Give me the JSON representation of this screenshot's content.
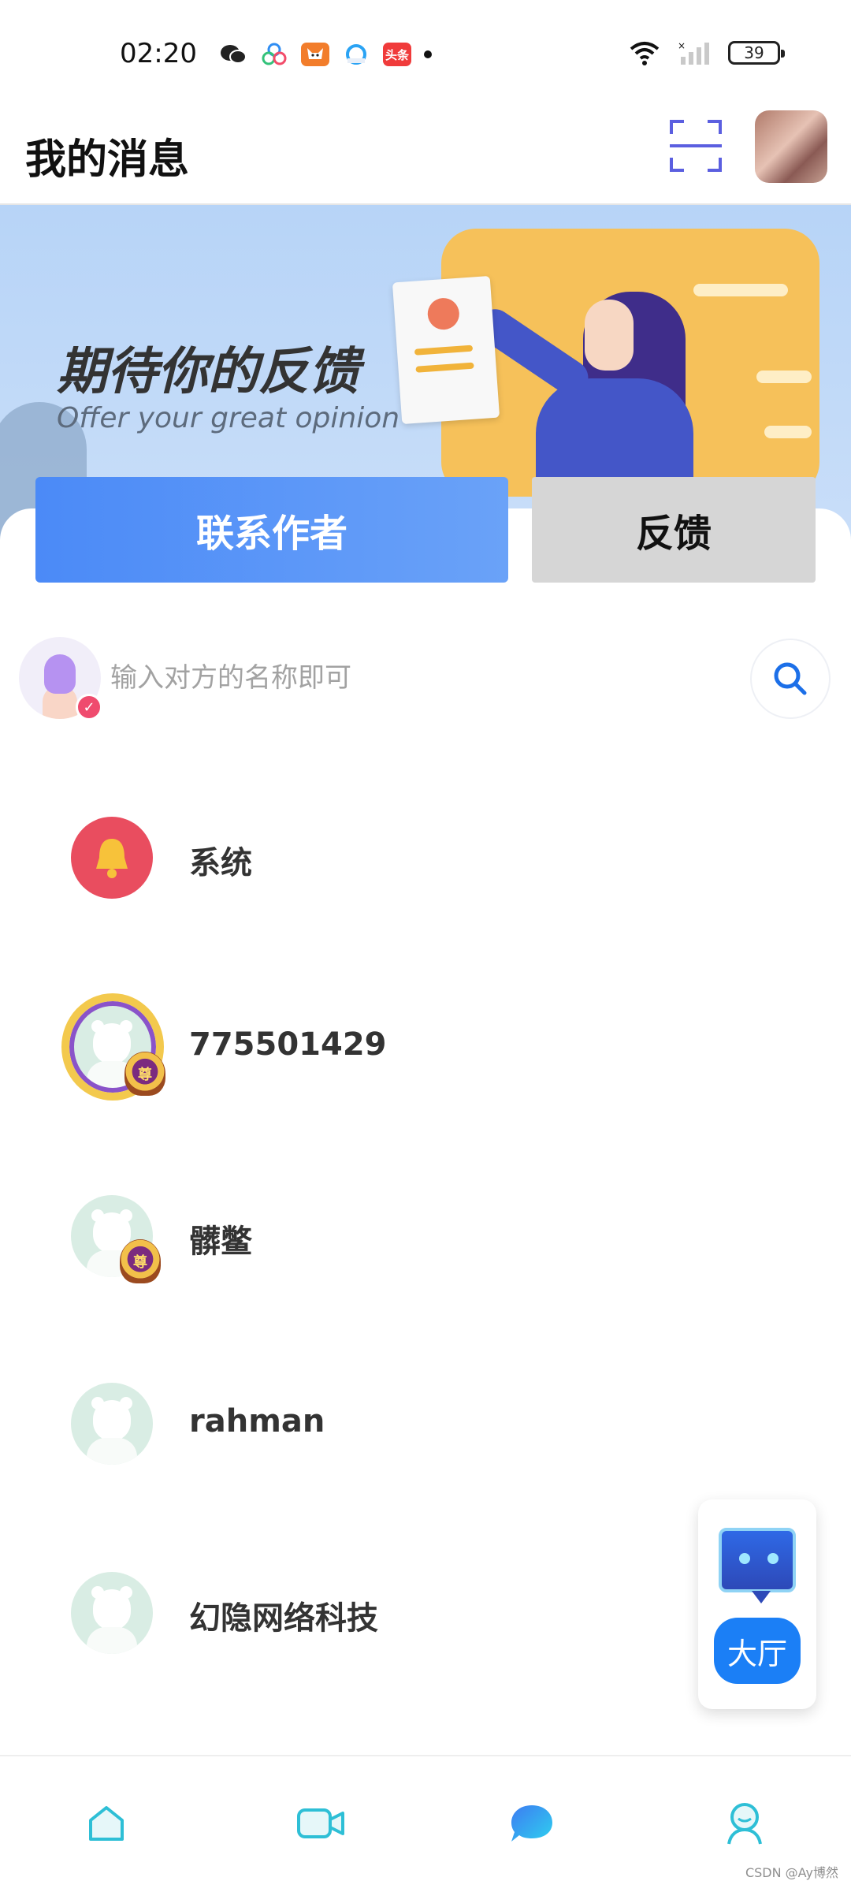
{
  "status_bar": {
    "time": "02:20",
    "battery": "39",
    "notification_icons": [
      "wechat-icon",
      "baidu-icon",
      "fox-app-icon",
      "browser-icon",
      "toutiao-icon"
    ],
    "toutiao_label": "头条"
  },
  "header": {
    "title": "我的消息",
    "scan_icon": "scan-icon",
    "avatar_icon": "user-avatar"
  },
  "banner": {
    "title": "期待你的反馈",
    "subtitle": "Offer your great opinion"
  },
  "actions": {
    "contact_label": "联系作者",
    "feedback_label": "反馈"
  },
  "search": {
    "placeholder": "输入对方的名称即可",
    "value": ""
  },
  "conversations": [
    {
      "name": "系统",
      "avatar": "bell-icon"
    },
    {
      "name": "775501429",
      "avatar": "crown-frame-avatar"
    },
    {
      "name": "髒鳖",
      "avatar": "bear-avatar-with-medal"
    },
    {
      "name": "rahman",
      "avatar": "bear-avatar"
    },
    {
      "name": "幻隐网络科技",
      "avatar": "bear-avatar"
    }
  ],
  "medal_text": "尊",
  "floating": {
    "hall_label": "大厅"
  },
  "nav": {
    "items": [
      "home-icon",
      "video-icon",
      "message-icon",
      "profile-icon"
    ]
  },
  "colors": {
    "primary": "#4b8af7",
    "hall": "#1b7ff6",
    "feedback_bg": "#d6d6d6",
    "bell_bg": "#e94d5f"
  },
  "watermark": "CSDN @Ay博然"
}
